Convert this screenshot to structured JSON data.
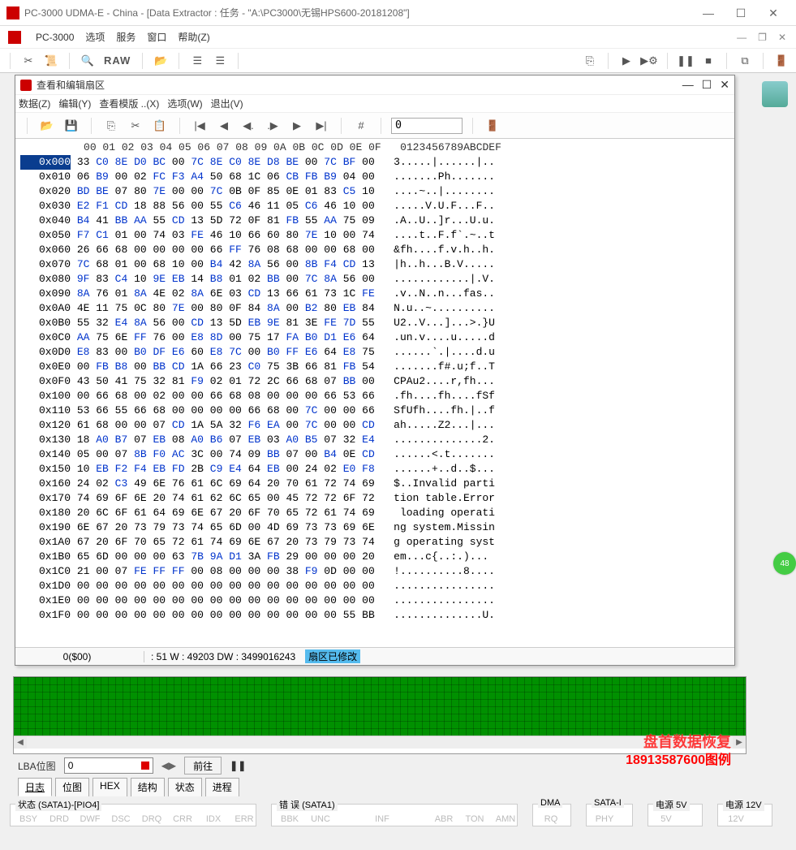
{
  "app": {
    "title": "PC-3000 UDMA-E - China - [Data Extractor : 任务 - \"A:\\PC3000\\无锡HPS600-20181208\"]",
    "name": "PC-3000"
  },
  "menu": {
    "opt": "选项",
    "svc": "服务",
    "win": "窗口",
    "help": "帮助(Z)"
  },
  "toolbar": {
    "raw": "RAW"
  },
  "badge48": "48",
  "hex": {
    "title": "查看和编辑扇区",
    "menu": {
      "data": "数据(Z)",
      "edit": "编辑(Y)",
      "view": "查看模版 ..(X)",
      "opts": "选项(W)",
      "exit": "退出(V)"
    },
    "offset_input": "0",
    "status": {
      "pos": "0($00)",
      "info": ": 51 W : 49203 DW : 3499016243",
      "chg": "扇区已修改"
    },
    "header": "   00 01 02 03 04 05 06 07 08 09 0A 0B 0C 0D 0E 0F   0123456789ABCDEF",
    "rows": [
      {
        "o": "0x000",
        "b": "33 C0 8E D0 BC 00 7C 8E C0 8E D8 BE 00 7C BF 00",
        "k": [
          1,
          0,
          0,
          0,
          0,
          1,
          0,
          0,
          0,
          0,
          0,
          0,
          1,
          0,
          0,
          1
        ],
        "a": "3.....|......|.."
      },
      {
        "o": "0x010",
        "b": "06 B9 00 02 FC F3 A4 50 68 1C 06 CB FB B9 04 00",
        "k": [
          1,
          0,
          1,
          1,
          0,
          0,
          0,
          1,
          1,
          1,
          1,
          0,
          0,
          0,
          1,
          1
        ],
        "a": ".......Ph......."
      },
      {
        "o": "0x020",
        "b": "BD BE 07 80 7E 00 00 7C 0B 0F 85 0E 01 83 C5 10",
        "k": [
          0,
          0,
          1,
          1,
          0,
          1,
          1,
          0,
          1,
          1,
          1,
          1,
          1,
          1,
          0,
          1
        ],
        "a": "....~..|........"
      },
      {
        "o": "0x030",
        "b": "E2 F1 CD 18 88 56 00 55 C6 46 11 05 C6 46 10 00",
        "k": [
          0,
          0,
          0,
          1,
          1,
          1,
          1,
          1,
          0,
          1,
          1,
          1,
          0,
          1,
          1,
          1
        ],
        "a": ".....V.U.F...F.."
      },
      {
        "o": "0x040",
        "b": "B4 41 BB AA 55 CD 13 5D 72 0F 81 FB 55 AA 75 09",
        "k": [
          0,
          1,
          0,
          0,
          1,
          0,
          1,
          1,
          1,
          1,
          1,
          0,
          1,
          0,
          1,
          1
        ],
        "a": ".A..U..]r...U.u."
      },
      {
        "o": "0x050",
        "b": "F7 C1 01 00 74 03 FE 46 10 66 60 80 7E 10 00 74",
        "k": [
          0,
          0,
          1,
          1,
          1,
          1,
          0,
          1,
          1,
          1,
          1,
          1,
          0,
          1,
          1,
          1
        ],
        "a": "....t..F.f`.~..t"
      },
      {
        "o": "0x060",
        "b": "26 66 68 00 00 00 00 66 FF 76 08 68 00 00 68 00",
        "k": [
          1,
          1,
          1,
          1,
          1,
          1,
          1,
          1,
          0,
          1,
          1,
          1,
          1,
          1,
          1,
          1
        ],
        "a": "&fh....f.v.h..h."
      },
      {
        "o": "0x070",
        "b": "7C 68 01 00 68 10 00 B4 42 8A 56 00 8B F4 CD 13",
        "k": [
          0,
          1,
          1,
          1,
          1,
          1,
          1,
          0,
          1,
          0,
          1,
          1,
          0,
          0,
          0,
          1
        ],
        "a": "|h..h...B.V....."
      },
      {
        "o": "0x080",
        "b": "9F 83 C4 10 9E EB 14 B8 01 02 BB 00 7C 8A 56 00",
        "k": [
          0,
          1,
          0,
          1,
          0,
          0,
          1,
          0,
          1,
          1,
          0,
          1,
          0,
          0,
          1,
          1
        ],
        "a": "............|.V."
      },
      {
        "o": "0x090",
        "b": "8A 76 01 8A 4E 02 8A 6E 03 CD 13 66 61 73 1C FE",
        "k": [
          0,
          1,
          1,
          0,
          1,
          1,
          0,
          1,
          1,
          0,
          1,
          1,
          1,
          1,
          1,
          0
        ],
        "a": ".v..N..n...fas.."
      },
      {
        "o": "0x0A0",
        "b": "4E 11 75 0C 80 7E 00 80 0F 84 8A 00 B2 80 EB 84",
        "k": [
          1,
          1,
          1,
          1,
          1,
          0,
          1,
          1,
          1,
          1,
          0,
          1,
          0,
          1,
          0,
          1
        ],
        "a": "N.u..~.........."
      },
      {
        "o": "0x0B0",
        "b": "55 32 E4 8A 56 00 CD 13 5D EB 9E 81 3E FE 7D 55",
        "k": [
          1,
          1,
          0,
          0,
          1,
          1,
          0,
          1,
          1,
          0,
          0,
          1,
          1,
          0,
          0,
          1
        ],
        "a": "U2..V...]...>.}U"
      },
      {
        "o": "0x0C0",
        "b": "AA 75 6E FF 76 00 E8 8D 00 75 17 FA B0 D1 E6 64",
        "k": [
          0,
          1,
          1,
          0,
          1,
          1,
          0,
          0,
          1,
          1,
          1,
          0,
          0,
          0,
          0,
          1
        ],
        "a": ".un.v....u.....d"
      },
      {
        "o": "0x0D0",
        "b": "E8 83 00 B0 DF E6 60 E8 7C 00 B0 FF E6 64 E8 75",
        "k": [
          0,
          1,
          1,
          0,
          0,
          0,
          1,
          0,
          0,
          1,
          0,
          0,
          0,
          1,
          0,
          1
        ],
        "a": "......`.|....d.u"
      },
      {
        "o": "0x0E0",
        "b": "00 FB B8 00 BB CD 1A 66 23 C0 75 3B 66 81 FB 54",
        "k": [
          1,
          0,
          0,
          1,
          0,
          0,
          1,
          1,
          1,
          0,
          1,
          1,
          1,
          1,
          0,
          1
        ],
        "a": ".......f#.u;f..T"
      },
      {
        "o": "0x0F0",
        "b": "43 50 41 75 32 81 F9 02 01 72 2C 66 68 07 BB 00",
        "k": [
          1,
          1,
          1,
          1,
          1,
          1,
          0,
          1,
          1,
          1,
          1,
          1,
          1,
          1,
          0,
          1
        ],
        "a": "CPAu2....r,fh..."
      },
      {
        "o": "0x100",
        "b": "00 66 68 00 02 00 00 66 68 08 00 00 00 66 53 66",
        "k": [
          1,
          1,
          1,
          1,
          1,
          1,
          1,
          1,
          1,
          1,
          1,
          1,
          1,
          1,
          1,
          1
        ],
        "a": ".fh....fh....fSf"
      },
      {
        "o": "0x110",
        "b": "53 66 55 66 68 00 00 00 00 66 68 00 7C 00 00 66",
        "k": [
          1,
          1,
          1,
          1,
          1,
          1,
          1,
          1,
          1,
          1,
          1,
          1,
          0,
          1,
          1,
          1
        ],
        "a": "SfUfh....fh.|..f"
      },
      {
        "o": "0x120",
        "b": "61 68 00 00 07 CD 1A 5A 32 F6 EA 00 7C 00 00 CD",
        "k": [
          1,
          1,
          1,
          1,
          1,
          0,
          1,
          1,
          1,
          0,
          0,
          1,
          0,
          1,
          1,
          0
        ],
        "a": "ah.....Z2...|..."
      },
      {
        "o": "0x130",
        "b": "18 A0 B7 07 EB 08 A0 B6 07 EB 03 A0 B5 07 32 E4",
        "k": [
          1,
          0,
          0,
          1,
          0,
          1,
          0,
          0,
          1,
          0,
          1,
          0,
          0,
          1,
          1,
          0
        ],
        "a": "..............2."
      },
      {
        "o": "0x140",
        "b": "05 00 07 8B F0 AC 3C 00 74 09 BB 07 00 B4 0E CD",
        "k": [
          1,
          1,
          1,
          0,
          0,
          0,
          1,
          1,
          1,
          1,
          0,
          1,
          1,
          0,
          1,
          0
        ],
        "a": "......<.t......."
      },
      {
        "o": "0x150",
        "b": "10 EB F2 F4 EB FD 2B C9 E4 64 EB 00 24 02 E0 F8",
        "k": [
          1,
          0,
          0,
          0,
          0,
          0,
          1,
          0,
          0,
          1,
          0,
          1,
          1,
          1,
          0,
          0
        ],
        "a": "......+..d..$..."
      },
      {
        "o": "0x160",
        "b": "24 02 C3 49 6E 76 61 6C 69 64 20 70 61 72 74 69",
        "k": [
          1,
          1,
          0,
          1,
          1,
          1,
          1,
          1,
          1,
          1,
          1,
          1,
          1,
          1,
          1,
          1
        ],
        "a": "$..Invalid parti"
      },
      {
        "o": "0x170",
        "b": "74 69 6F 6E 20 74 61 62 6C 65 00 45 72 72 6F 72",
        "k": [
          1,
          1,
          1,
          1,
          1,
          1,
          1,
          1,
          1,
          1,
          1,
          1,
          1,
          1,
          1,
          1
        ],
        "a": "tion table.Error"
      },
      {
        "o": "0x180",
        "b": "20 6C 6F 61 64 69 6E 67 20 6F 70 65 72 61 74 69",
        "k": [
          1,
          1,
          1,
          1,
          1,
          1,
          1,
          1,
          1,
          1,
          1,
          1,
          1,
          1,
          1,
          1
        ],
        "a": " loading operati"
      },
      {
        "o": "0x190",
        "b": "6E 67 20 73 79 73 74 65 6D 00 4D 69 73 73 69 6E",
        "k": [
          1,
          1,
          1,
          1,
          1,
          1,
          1,
          1,
          1,
          1,
          1,
          1,
          1,
          1,
          1,
          1
        ],
        "a": "ng system.Missin"
      },
      {
        "o": "0x1A0",
        "b": "67 20 6F 70 65 72 61 74 69 6E 67 20 73 79 73 74",
        "k": [
          1,
          1,
          1,
          1,
          1,
          1,
          1,
          1,
          1,
          1,
          1,
          1,
          1,
          1,
          1,
          1
        ],
        "a": "g operating syst"
      },
      {
        "o": "0x1B0",
        "b": "65 6D 00 00 00 63 7B 9A D1 3A FB 29 00 00 00 20",
        "k": [
          1,
          1,
          1,
          1,
          1,
          1,
          0,
          0,
          0,
          1,
          0,
          1,
          1,
          1,
          1,
          1
        ],
        "a": "em...c{..:.)... "
      },
      {
        "o": "0x1C0",
        "b": "21 00 07 FE FF FF 00 08 00 00 00 38 F9 0D 00 00",
        "k": [
          1,
          1,
          1,
          0,
          0,
          0,
          1,
          1,
          1,
          1,
          1,
          1,
          0,
          1,
          1,
          1
        ],
        "a": "!..........8...."
      },
      {
        "o": "0x1D0",
        "b": "00 00 00 00 00 00 00 00 00 00 00 00 00 00 00 00",
        "k": [
          1,
          1,
          1,
          1,
          1,
          1,
          1,
          1,
          1,
          1,
          1,
          1,
          1,
          1,
          1,
          1
        ],
        "a": "................"
      },
      {
        "o": "0x1E0",
        "b": "00 00 00 00 00 00 00 00 00 00 00 00 00 00 00 00",
        "k": [
          1,
          1,
          1,
          1,
          1,
          1,
          1,
          1,
          1,
          1,
          1,
          1,
          1,
          1,
          1,
          1
        ],
        "a": "................"
      },
      {
        "o": "0x1F0",
        "b": "00 00 00 00 00 00 00 00 00 00 00 00 00 00 55 BB",
        "k": [
          1,
          1,
          1,
          1,
          1,
          1,
          1,
          1,
          1,
          1,
          1,
          1,
          1,
          1,
          1,
          1
        ],
        "a": "..............U."
      }
    ]
  },
  "lba": {
    "label": "LBA位图",
    "value": "0",
    "go": "前往",
    "watermark1": "盘首数据恢复",
    "watermark2": "18913587600图例"
  },
  "tabs": {
    "log": "日志",
    "map": "位图",
    "hex": "HEX",
    "struct": "结构",
    "status": "状态",
    "proc": "进程"
  },
  "status": {
    "g1": {
      "t": "状态 (SATA1)-[PIO4]",
      "items": [
        "BSY",
        "DRD",
        "DWF",
        "DSC",
        "DRQ",
        "CRR",
        "IDX",
        "ERR"
      ]
    },
    "g2": {
      "t": "错 误 (SATA1)",
      "items": [
        "BBK",
        "UNC",
        "",
        "INF",
        "",
        "ABR",
        "TON",
        "AMN"
      ]
    },
    "g3": {
      "t": "DMA",
      "items": [
        "RQ"
      ]
    },
    "g4": {
      "t": "SATA-I",
      "items": [
        "PHY"
      ]
    },
    "g5": {
      "t": "电源 5V",
      "items": [
        "5V"
      ]
    },
    "g6": {
      "t": "电源 12V",
      "items": [
        "12V"
      ]
    }
  }
}
